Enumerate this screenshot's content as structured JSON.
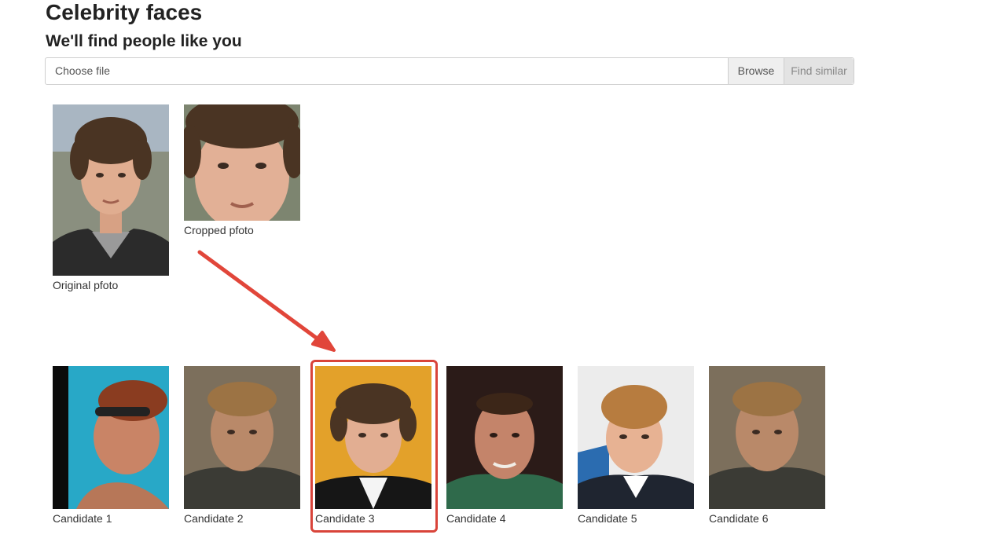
{
  "header": {
    "title": "Celebrity faces",
    "subtitle": "We'll find people like you"
  },
  "upload": {
    "placeholder": "Choose file",
    "browse_label": "Browse",
    "find_label": "Find similar"
  },
  "input_photos": [
    {
      "caption": "Original pfoto"
    },
    {
      "caption": "Cropped pfoto"
    }
  ],
  "candidates": [
    {
      "caption": "Candidate 1"
    },
    {
      "caption": "Candidate 2"
    },
    {
      "caption": "Candidate 3",
      "highlighted": true
    },
    {
      "caption": "Candidate 4"
    },
    {
      "caption": "Candidate 5"
    },
    {
      "caption": "Candidate 6"
    }
  ],
  "colors": {
    "highlight": "#d9443a",
    "arrow": "#e1463a"
  }
}
